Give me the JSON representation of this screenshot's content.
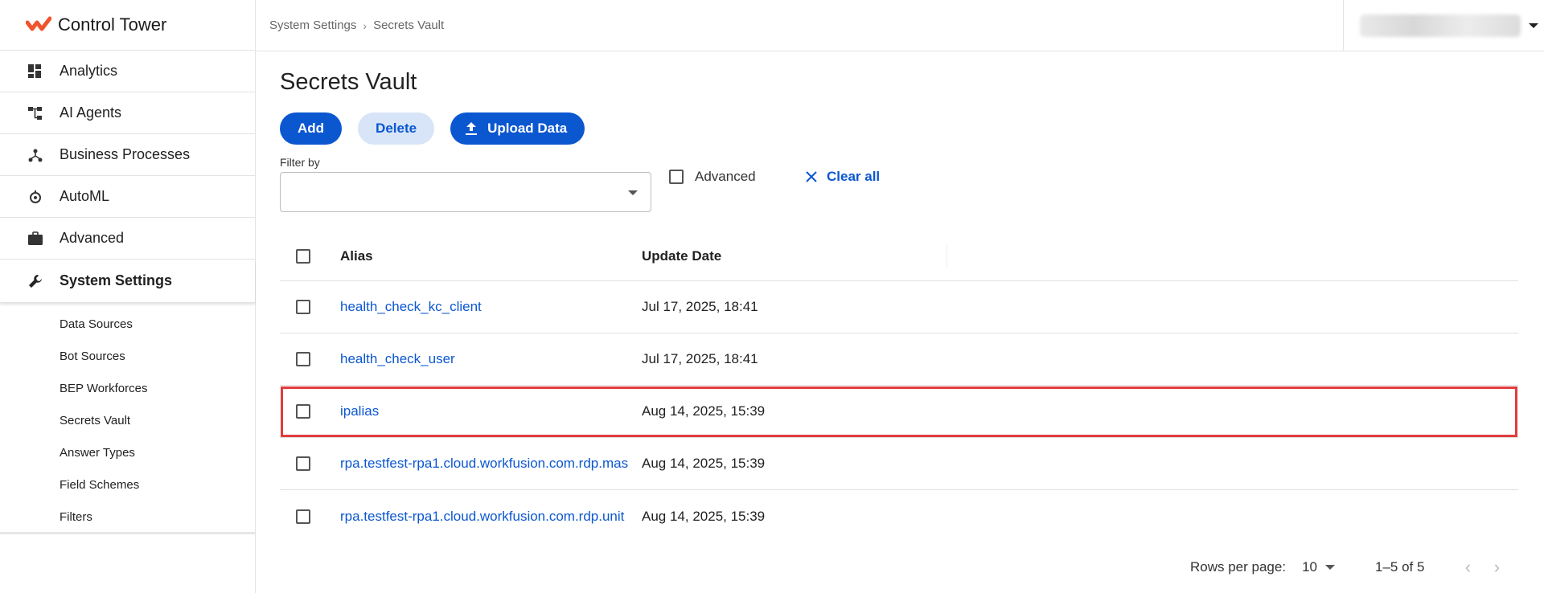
{
  "app": {
    "title": "Control Tower",
    "brand_color": "#f0542d"
  },
  "sidebar": {
    "items": [
      {
        "label": "Analytics",
        "icon": "dashboard-icon"
      },
      {
        "label": "AI Agents",
        "icon": "hierarchy-icon"
      },
      {
        "label": "Business Processes",
        "icon": "process-icon"
      },
      {
        "label": "AutoML",
        "icon": "automl-icon"
      },
      {
        "label": "Advanced",
        "icon": "briefcase-icon"
      },
      {
        "label": "System Settings",
        "icon": "wrench-icon",
        "active": true
      }
    ],
    "subitems": [
      "Data Sources",
      "Bot Sources",
      "BEP Workforces",
      "Secrets Vault",
      "Answer Types",
      "Field Schemes",
      "Filters"
    ]
  },
  "breadcrumb": {
    "parent": "System Settings",
    "current": "Secrets Vault"
  },
  "page": {
    "title": "Secrets Vault"
  },
  "actions": {
    "add": "Add",
    "delete": "Delete",
    "upload": "Upload Data"
  },
  "filter": {
    "label": "Filter by",
    "value": "",
    "advanced": "Advanced",
    "clear": "Clear all"
  },
  "table": {
    "columns": [
      "Alias",
      "Update Date"
    ],
    "rows": [
      {
        "alias": "health_check_kc_client",
        "date": "Jul 17, 2025, 18:41"
      },
      {
        "alias": "health_check_user",
        "date": "Jul 17, 2025, 18:41"
      },
      {
        "alias": "ipalias",
        "date": "Aug 14, 2025, 15:39",
        "highlighted": true
      },
      {
        "alias": "rpa.testfest-rpa1.cloud.workfusion.com.rdp.mas",
        "date": "Aug 14, 2025, 15:39"
      },
      {
        "alias": "rpa.testfest-rpa1.cloud.workfusion.com.rdp.unit",
        "date": "Aug 14, 2025, 15:39"
      }
    ]
  },
  "pagination": {
    "rows_label": "Rows per page:",
    "rows_value": "10",
    "range": "1–5 of 5"
  },
  "colors": {
    "primary": "#0b57d0",
    "secondary_bg": "#d8e5f8",
    "highlight": "#e23c3c"
  }
}
